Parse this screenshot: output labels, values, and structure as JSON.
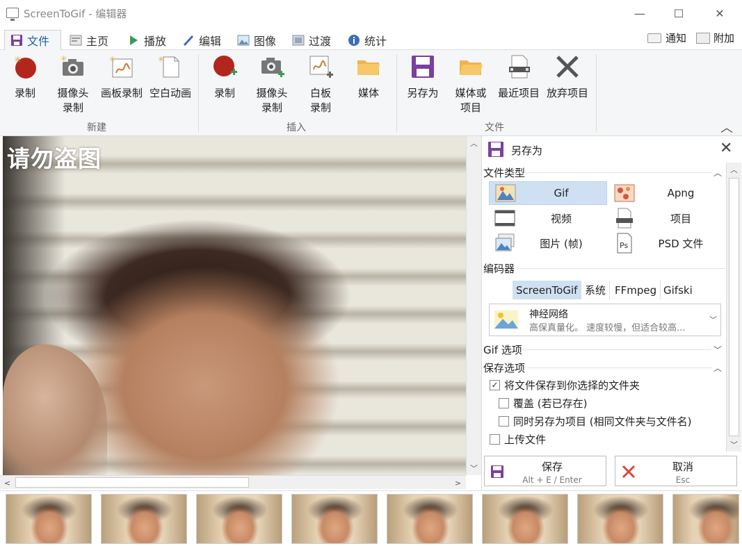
{
  "window": {
    "title": "ScreenToGif - 编辑器",
    "minimize": "—",
    "maximize": "☐",
    "close": "✕"
  },
  "tabs": [
    {
      "label": "文件",
      "icon": "floppy-icon",
      "active": true
    },
    {
      "label": "主页",
      "icon": "home-icon"
    },
    {
      "label": "播放",
      "icon": "play-icon"
    },
    {
      "label": "编辑",
      "icon": "pencil-icon"
    },
    {
      "label": "图像",
      "icon": "image-icon"
    },
    {
      "label": "过渡",
      "icon": "transition-icon"
    },
    {
      "label": "统计",
      "icon": "info-icon"
    }
  ],
  "top_right": {
    "notify": "通知",
    "extras": "附加"
  },
  "ribbon": {
    "new_group": {
      "label": "新建",
      "items": [
        {
          "line1": "录制",
          "line2": "",
          "icon": "record-icon"
        },
        {
          "line1": "摄像头",
          "line2": "录制",
          "icon": "camera-icon"
        },
        {
          "line1": "画板录制",
          "line2": "",
          "icon": "board-icon"
        },
        {
          "line1": "空白动画",
          "line2": "",
          "icon": "blank-icon"
        }
      ]
    },
    "insert_group": {
      "label": "插入",
      "items": [
        {
          "line1": "录制",
          "line2": "",
          "icon": "record-add-icon"
        },
        {
          "line1": "摄像头",
          "line2": "录制",
          "icon": "camera-add-icon"
        },
        {
          "line1": "白板",
          "line2": "录制",
          "icon": "board-add-icon"
        },
        {
          "line1": "媒体",
          "line2": "",
          "icon": "folder-icon"
        }
      ]
    },
    "file_group": {
      "label": "文件",
      "items": [
        {
          "line1": "另存为",
          "line2": "",
          "icon": "save-as-icon"
        },
        {
          "line1": "媒体或",
          "line2": "项目",
          "icon": "open-folder-icon"
        },
        {
          "line1": "最近项目",
          "line2": "",
          "icon": "recent-icon"
        },
        {
          "line1": "放弃项目",
          "line2": "",
          "icon": "discard-icon"
        }
      ]
    }
  },
  "canvas": {
    "watermark": "请勿盗图"
  },
  "panel": {
    "title": "另存为",
    "file_type_label": "文件类型",
    "file_types": [
      {
        "label": "Gif",
        "selected": true
      },
      {
        "label": "Apng"
      },
      {
        "label": "视频"
      },
      {
        "label": "项目"
      },
      {
        "label": "图片 (帧)"
      },
      {
        "label": "PSD 文件"
      }
    ],
    "encoder_label": "编码器",
    "encoders": [
      "ScreenToGif",
      "系统",
      "FFmpeg",
      "Gifski"
    ],
    "preset": {
      "title": "神经网络",
      "desc": "高保真量化。 速度较慢，但适合较高..."
    },
    "gif_options_label": "Gif 选项",
    "save_options_label": "保存选项",
    "options": [
      {
        "label": "将文件保存到你选择的文件夹",
        "checked": true
      },
      {
        "label": "覆盖 (若已存在)",
        "checked": false
      },
      {
        "label": "同时另存为项目 (相同文件夹与文件名)",
        "checked": false
      },
      {
        "label": "上传文件",
        "checked": false
      }
    ],
    "save_button": {
      "label": "保存",
      "shortcut": "Alt + E / Enter"
    },
    "cancel_button": {
      "label": "取消",
      "shortcut": "Esc"
    }
  },
  "filmstrip": {
    "frames": [
      "",
      "",
      "",
      "",
      "",
      "",
      "",
      ""
    ]
  },
  "colors": {
    "accent": "#1e5fa8",
    "selected": "#cfe0f3",
    "record_red": "#b3261e",
    "save_purple": "#7b3fa0",
    "folder_orange": "#f0b34a"
  }
}
